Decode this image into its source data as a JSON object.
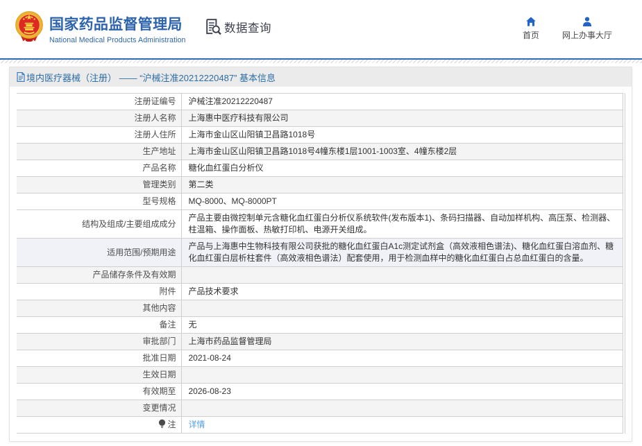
{
  "header": {
    "agency_cn": "国家药品监督管理局",
    "agency_en": "National Medical Products Administration",
    "section_label": "数据查询",
    "nav": [
      {
        "id": "home",
        "icon": "home-icon",
        "label": "首页"
      },
      {
        "id": "service-hall",
        "icon": "user-icon",
        "label": "网上办事大厅"
      }
    ]
  },
  "breadcrumb": {
    "text": "境内医疗器械（注册） —— “沪械注准20212220487” 基本信息"
  },
  "table": {
    "rows": [
      {
        "label": "注册证编号",
        "value": "沪械注准20212220487",
        "shade": "white",
        "size": "single"
      },
      {
        "label": "注册人名称",
        "value": "上海惠中医疗科技有限公司",
        "shade": "gray",
        "size": "single"
      },
      {
        "label": "注册人住所",
        "value": "上海市金山区山阳镇卫昌路1018号",
        "shade": "white",
        "size": "single"
      },
      {
        "label": "生产地址",
        "value": "上海市金山区山阳镇卫昌路1018号4幢东楼1层1001-1003室、4幢东楼2层",
        "shade": "gray",
        "size": "single"
      },
      {
        "label": "产品名称",
        "value": "糖化血红蛋白分析仪",
        "shade": "white",
        "size": "single"
      },
      {
        "label": "管理类别",
        "value": "第二类",
        "shade": "gray",
        "size": "single"
      },
      {
        "label": "型号规格",
        "value": "MQ-8000、MQ-8000PT",
        "shade": "white",
        "size": "single"
      },
      {
        "label": "结构及组成/主要组成成分",
        "value": "产品主要由微控制单元含糖化血红蛋白分析仪系统软件(发布版本1)、条码扫描器、自动加样机构、高压泵、检测器、柱温箱、操作面板、热敏打印机、电源开关组成。",
        "shade": "white",
        "size": "double"
      },
      {
        "label": "适用范围/预期用途",
        "value": "产品与上海惠中生物科技有限公司获批的糖化血红蛋白A1c测定试剂盒（高效液相色谱法)、糖化血红蛋白溶血剂、糖化血红蛋白层析柱套件（高效液相色谱法）配套使用，用于检测血样中的糖化血红蛋白占总血红蛋白的含量。",
        "shade": "blue",
        "size": "double"
      },
      {
        "label": "产品储存条件及有效期",
        "value": "",
        "shade": "gray",
        "size": "single"
      },
      {
        "label": "附件",
        "value": "产品技术要求",
        "shade": "white",
        "size": "single"
      },
      {
        "label": "其他内容",
        "value": "",
        "shade": "gray",
        "size": "single"
      },
      {
        "label": "备注",
        "value": "无",
        "shade": "white",
        "size": "single"
      },
      {
        "label": "审批部门",
        "value": "上海市药品监督管理局",
        "shade": "gray",
        "size": "single"
      },
      {
        "label": "批准日期",
        "value": "2021-08-24",
        "shade": "white",
        "size": "single"
      },
      {
        "label": "生效日期",
        "value": "",
        "shade": "gray",
        "size": "single"
      },
      {
        "label": "有效期至",
        "value": "2026-08-23",
        "shade": "white",
        "size": "single"
      },
      {
        "label": "变更情况",
        "value": "",
        "shade": "gray",
        "size": "single"
      },
      {
        "label": "注",
        "value": "详情",
        "shade": "white",
        "size": "single",
        "label_icon": "bulb-icon",
        "value_is_link": true
      }
    ]
  },
  "colors": {
    "brand_blue": "#2d63ac",
    "divider_blue": "#2e6cb3",
    "crumb_bg": "#ebebeb",
    "crumb_text": "#2d6da6",
    "link_blue": "#56a0e8",
    "row_gray": "#f4f4f4",
    "row_blue": "#f0f2f7"
  }
}
